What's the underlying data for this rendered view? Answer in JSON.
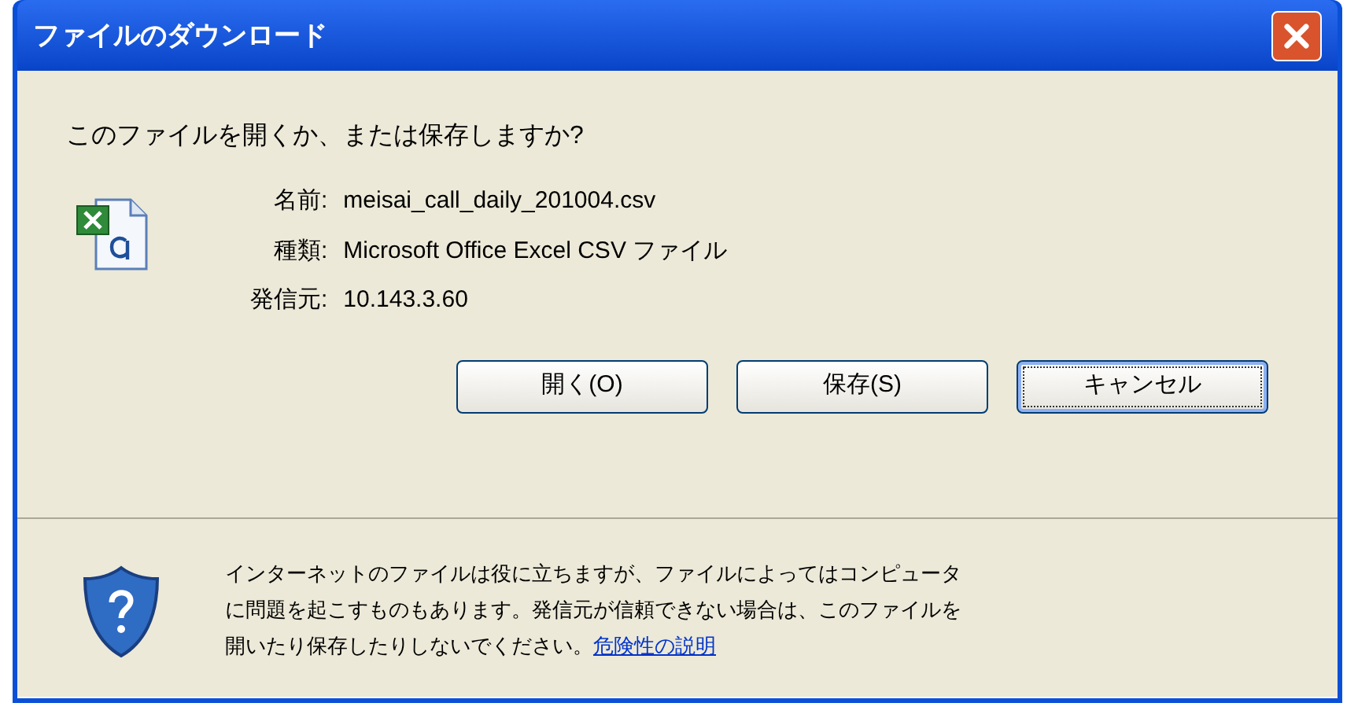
{
  "window": {
    "title": "ファイルのダウンロード"
  },
  "question": "このファイルを開くか、または保存しますか?",
  "file_info": [
    {
      "label": "名前:",
      "value": "meisai_call_daily_201004.csv"
    },
    {
      "label": "種類:",
      "value": "Microsoft Office Excel CSV ファイル"
    },
    {
      "label": "発信元:",
      "value": "10.143.3.60"
    }
  ],
  "buttons": [
    {
      "label": "開く(O)",
      "focused": false
    },
    {
      "label": "保存(S)",
      "focused": false
    },
    {
      "label": "キャンセル",
      "focused": true
    }
  ],
  "warning": {
    "text": "インターネットのファイルは役に立ちますが、ファイルによってはコンピュータに問題を起こすものもあります。発信元が信頼できない場合は、このファイルを開いたり保存したりしないでください。",
    "link": "危険性の説明"
  }
}
